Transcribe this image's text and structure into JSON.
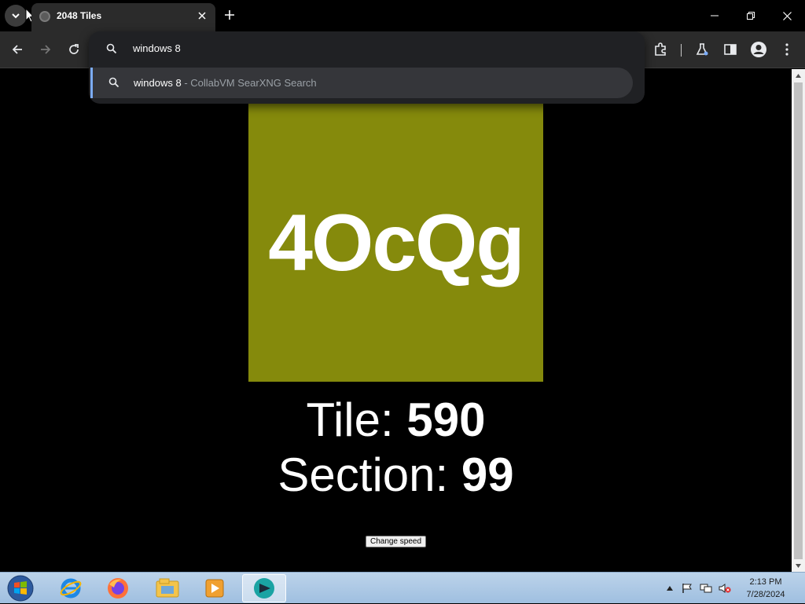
{
  "browser": {
    "tab": {
      "title": "2048 Tiles"
    },
    "omnibox": {
      "query": "windows 8",
      "suggestion_main": "windows 8",
      "suggestion_separator": " - ",
      "suggestion_sub": "CollabVM SearXNG Search"
    }
  },
  "page": {
    "tile": {
      "text": "4OcQg",
      "color": "#858a0c"
    },
    "tile_label": "Tile: ",
    "tile_value": "590",
    "section_label": "Section: ",
    "section_value": "99",
    "change_speed_label": "Change speed"
  },
  "taskbar": {
    "apps": [
      "internet-explorer-icon",
      "firefox-icon",
      "file-explorer-icon",
      "media-player-icon",
      "chromium-browser-icon"
    ],
    "clock_time": "2:13 PM",
    "clock_date": "7/28/2024"
  }
}
